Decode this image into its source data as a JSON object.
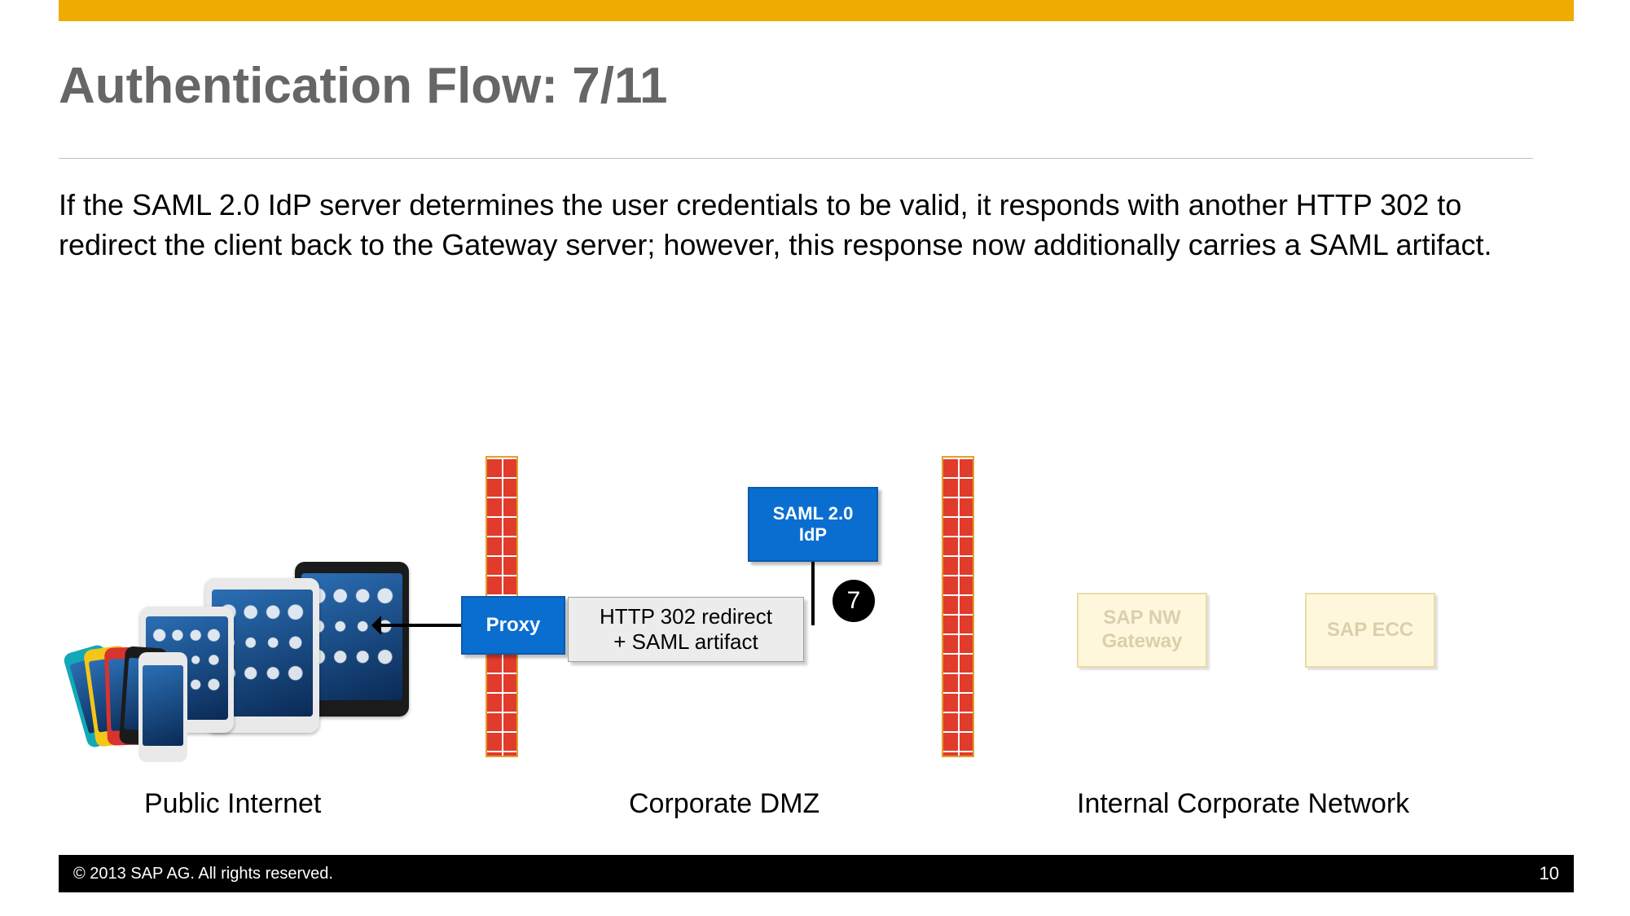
{
  "header": {
    "title": "Authentication Flow: 7/11"
  },
  "body": {
    "text": "If the SAML 2.0 IdP server determines the user credentials to be valid, it responds with another HTTP 302 to redirect the client back to the Gateway server; however, this response now additionally carries a SAML artifact."
  },
  "diagram": {
    "zones": {
      "public": "Public Internet",
      "dmz": "Corporate DMZ",
      "internal": "Internal Corporate Network"
    },
    "nodes": {
      "proxy": "Proxy",
      "idp_line1": "SAML 2.0",
      "idp_line2": "IdP",
      "nw_gateway_line1": "SAP NW",
      "nw_gateway_line2": "Gateway",
      "ecc": "SAP ECC"
    },
    "message": {
      "line1": "HTTP 302 redirect",
      "line2": "+ SAML artifact"
    },
    "step": "7"
  },
  "footer": {
    "copyright": "©  2013 SAP AG. All rights reserved.",
    "page": "10"
  }
}
